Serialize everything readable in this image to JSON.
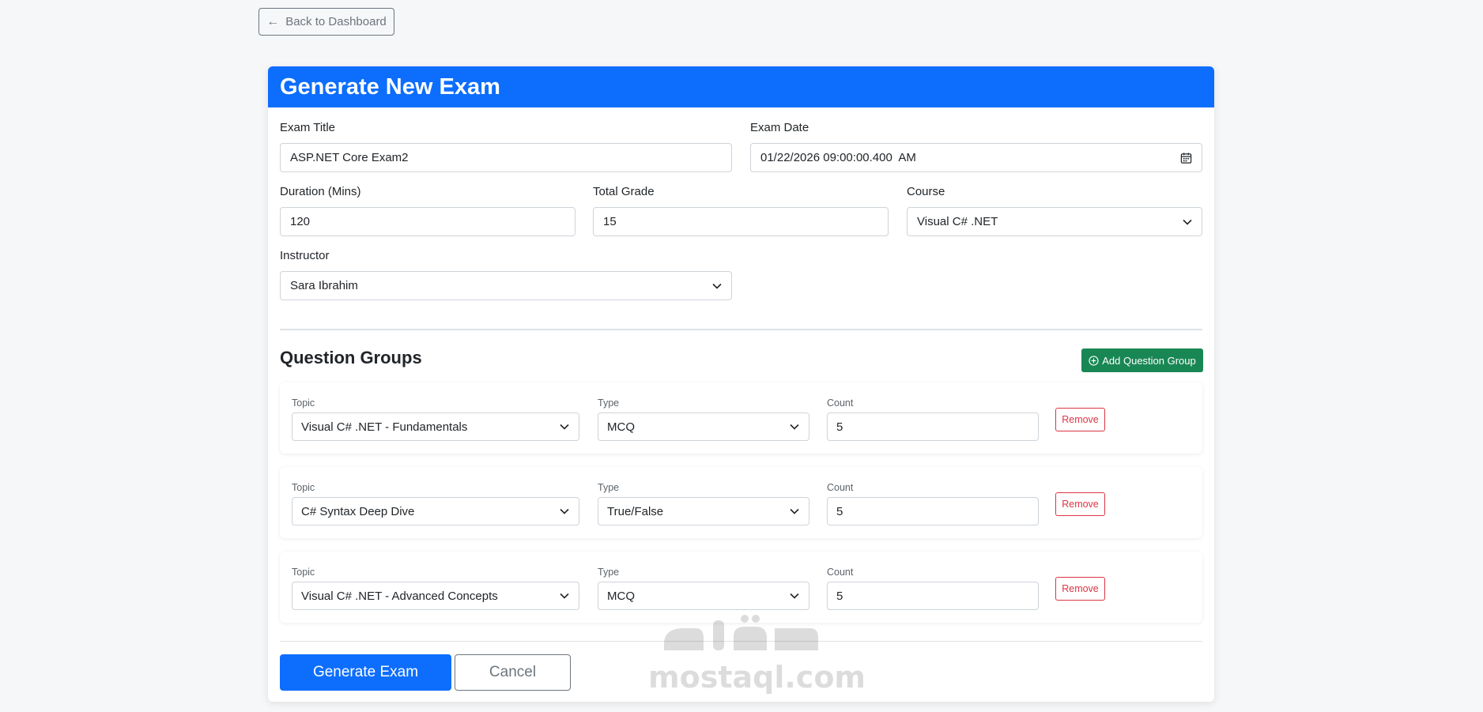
{
  "nav": {
    "back_label": "Back to Dashboard"
  },
  "form": {
    "title": "Generate New Exam",
    "exam_title": {
      "label": "Exam Title",
      "value": "ASP.NET Core Exam2"
    },
    "exam_date": {
      "label": "Exam Date",
      "value": "01/22/2026 09:00:00.400  AM"
    },
    "duration": {
      "label": "Duration (Mins)",
      "value": "120"
    },
    "total_grade": {
      "label": "Total Grade",
      "value": "15"
    },
    "course": {
      "label": "Course",
      "value": "Visual C# .NET"
    },
    "instructor": {
      "label": "Instructor",
      "value": "Sara Ibrahim"
    }
  },
  "question_groups": {
    "title": "Question Groups",
    "add_label": "Add Question Group",
    "topic_label": "Topic",
    "type_label": "Type",
    "count_label": "Count",
    "remove_label": "Remove",
    "groups": [
      {
        "topic": "Visual C# .NET - Fundamentals",
        "type": "MCQ",
        "count": "5"
      },
      {
        "topic": "C# Syntax Deep Dive",
        "type": "True/False",
        "count": "5"
      },
      {
        "topic": "Visual C# .NET - Advanced Concepts",
        "type": "MCQ",
        "count": "5"
      }
    ]
  },
  "actions": {
    "generate_label": "Generate Exam",
    "cancel_label": "Cancel"
  },
  "watermark": {
    "text": "mostaql.com",
    "logo_text": "مستقل"
  },
  "colors": {
    "primary": "#0d6efd",
    "success": "#198754",
    "danger": "#dc3545",
    "secondary": "#6c757d"
  }
}
